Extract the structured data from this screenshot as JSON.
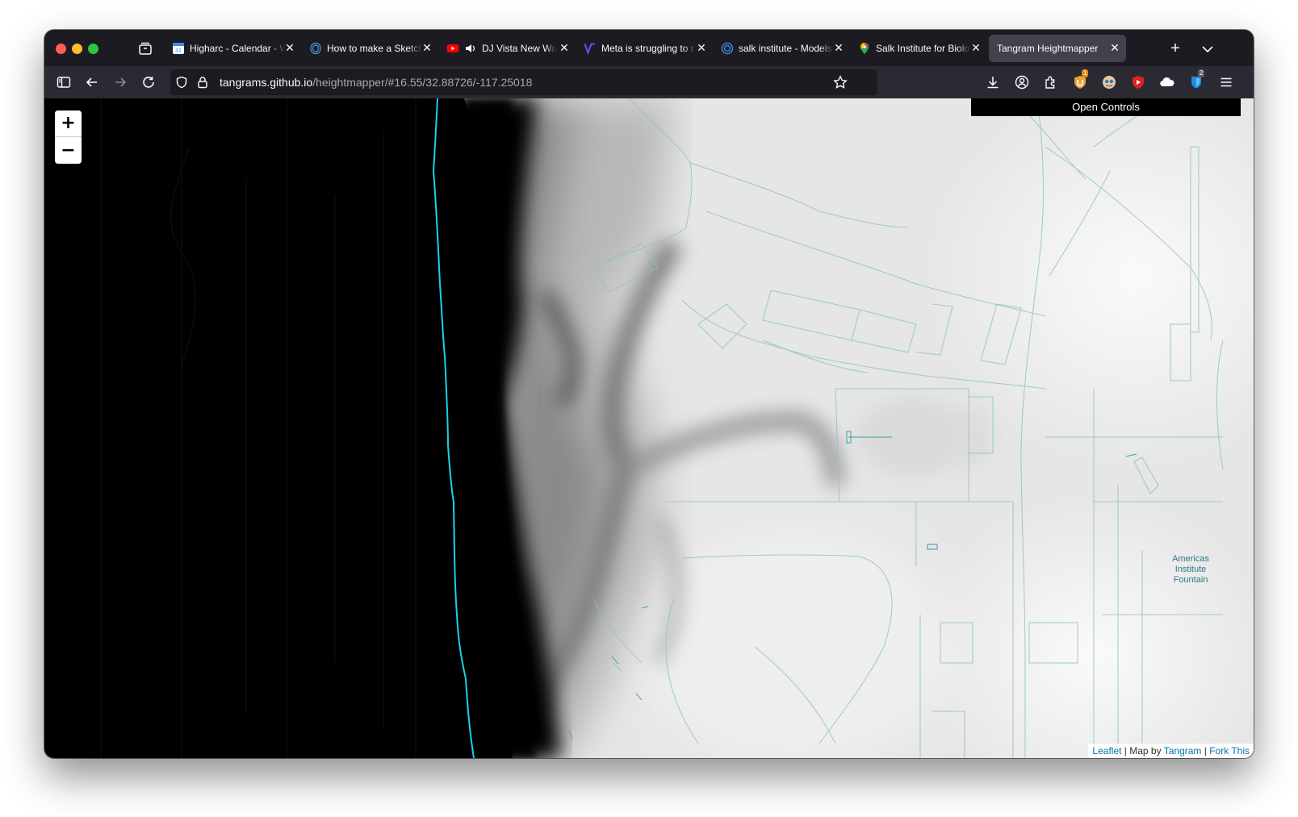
{
  "browser": {
    "tabs": [
      {
        "title": "Higharc - Calendar - W",
        "icon": "google-calendar-icon",
        "active": false
      },
      {
        "title": "How to make a Sketch",
        "icon": "sketch-logo-icon",
        "active": false
      },
      {
        "title": "DJ Vista New Wav",
        "icon": "youtube-icon",
        "active": false,
        "audio": true
      },
      {
        "title": "Meta is struggling to r",
        "icon": "verge-logo-icon",
        "active": false
      },
      {
        "title": "salk institute - Models",
        "icon": "spiral-logo-icon",
        "active": false
      },
      {
        "title": "Salk Institute for Biolo",
        "icon": "google-maps-pin-icon",
        "active": false
      },
      {
        "title": "Tangram Heightmapper",
        "icon": "",
        "active": true
      }
    ],
    "url": {
      "host": "tangrams.github.io",
      "path": "/heightmapper/#16.55/32.88726/-117.25018"
    },
    "toolbar_icons": [
      "sidebar-icon",
      "back-icon",
      "forward-icon",
      "reload-icon",
      "shield-icon",
      "lock-icon",
      "bookmark-star-icon",
      "download-icon",
      "account-icon",
      "extensions-icon",
      "ublock-icon",
      "ghostery-icon",
      "youtube-extension-icon",
      "cloud-extension-icon",
      "bitwarden-icon",
      "menu-icon"
    ],
    "badges": {
      "ublock": "1",
      "bitwarden": "2"
    }
  },
  "map": {
    "zoom_in_label": "+",
    "zoom_out_label": "−",
    "controls_label": "Open Controls",
    "poi_label": "Americas\nInstitute\nFountain",
    "attribution": {
      "leaflet": "Leaflet",
      "sep1": " | Map by ",
      "tangram": "Tangram",
      "sep2": " | ",
      "fork": "Fork This"
    },
    "colors": {
      "coastline": "#19d3e6",
      "roads": "#8ec3c3",
      "ocean": "#000000"
    }
  }
}
